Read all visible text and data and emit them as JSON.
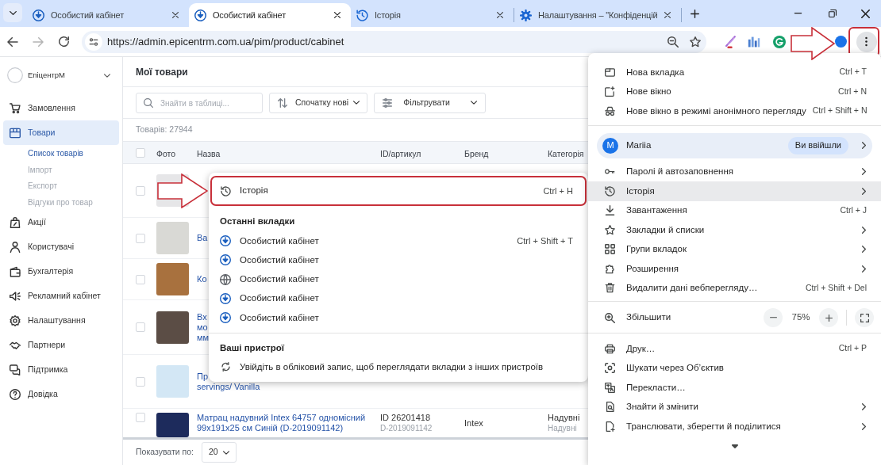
{
  "tab_strip": {
    "tabs": [
      {
        "title": "Особистий кабінет",
        "kind": "site",
        "selected": false
      },
      {
        "title": "Особистий кабінет",
        "kind": "site",
        "selected": true
      },
      {
        "title": "Історія",
        "kind": "history",
        "selected": false
      },
      {
        "title": "Налаштування – \"Конфіденцій",
        "kind": "settings",
        "selected": false
      }
    ]
  },
  "toolbar": {
    "url": "https://admin.epicentrm.com.ua/pim/product/cabinet",
    "navigation": {
      "back_disabled": false,
      "forward_disabled": true
    },
    "menu_button": {
      "annotated": true
    }
  },
  "sidebar": {
    "account": "ЕпіцентрМ",
    "items": [
      {
        "label": "Замовлення",
        "selected": false
      },
      {
        "label": "Товари",
        "selected": true,
        "children": [
          {
            "label": "Список товарів",
            "selected": true
          },
          {
            "label": "Імпорт",
            "selected": false
          },
          {
            "label": "Експорт",
            "selected": false
          },
          {
            "label": "Відгуки про товар",
            "selected": false
          }
        ]
      },
      {
        "label": "Акції",
        "selected": false
      },
      {
        "label": "Користувачі",
        "selected": false
      },
      {
        "label": "Бухгалтерія",
        "selected": false
      },
      {
        "label": "Рекламний кабінет",
        "selected": false
      },
      {
        "label": "Налаштування",
        "selected": false
      },
      {
        "label": "Партнери",
        "selected": false
      },
      {
        "label": "Підтримка",
        "selected": false
      },
      {
        "label": "Довідка",
        "selected": false
      }
    ]
  },
  "main": {
    "title": "Мої товари",
    "search": {
      "placeholder": "Знайти в таблиці..."
    },
    "sort": {
      "label": "Спочатку нові"
    },
    "filter": {
      "label": "Фільтрувати"
    },
    "count": "Товарів: 27944",
    "table": {
      "all_checked": false,
      "columns": [
        "Фото",
        "Назва",
        "ID/артикул",
        "Бренд",
        "Категорія"
      ],
      "rows": [
        {
          "checked": false
        },
        {
          "checked": false,
          "name": [
            "Ва"
          ]
        },
        {
          "checked": false,
          "name": [
            "Ко"
          ]
        },
        {
          "checked": false,
          "name": [
            "Вх",
            "мо",
            "мм"
          ]
        },
        {
          "checked": false,
          "name": [
            "Пр",
            "servings/ Vanilla"
          ]
        },
        {
          "checked": false,
          "name": [
            "Матрац надувний Intex 64757 одномісний",
            "99x191x25 см Синій (D-2019091142)"
          ],
          "id": [
            "ID 26201418",
            "D-2019091142"
          ],
          "brand": "Intex",
          "category": [
            "Надувні",
            "Надувні"
          ]
        }
      ]
    },
    "footer": {
      "label": "Показувати по:",
      "page_size": "20"
    }
  },
  "history_submenu": {
    "history_item": {
      "label": "Історія",
      "shortcut": "Ctrl + H",
      "annotated": true
    },
    "recent_heading": "Останні вкладки",
    "recent_tabs": [
      {
        "title": "Особистий кабінет",
        "kind": "site",
        "shortcut": "Ctrl + Shift + T"
      },
      {
        "title": "Особистий кабінет",
        "kind": "site"
      },
      {
        "title": "Особистий кабінет",
        "kind": "web"
      },
      {
        "title": "Особистий кабінет",
        "kind": "site"
      },
      {
        "title": "Особистий кабінет",
        "kind": "site"
      }
    ],
    "devices_heading": "Ваші пристрої",
    "sign_in_prompt": "Увійдіть в обліковий запис, щоб переглядати вкладки з інших пристроїв"
  },
  "chrome_menu": {
    "sections": [
      {
        "items": [
          {
            "kind": "command",
            "label": "Нова вкладка",
            "shortcut": "Ctrl + T",
            "submenu": false,
            "selected": false
          },
          {
            "kind": "command",
            "label": "Нове вікно",
            "shortcut": "Ctrl + N",
            "submenu": false,
            "selected": false
          },
          {
            "kind": "command",
            "label": "Нове вікно в режимі анонімного перегляду",
            "shortcut": "Ctrl + Shift + N",
            "submenu": false,
            "selected": false
          }
        ]
      },
      {
        "items": [
          {
            "kind": "profile",
            "avatar": "M",
            "name": "Mariia",
            "status": "Ви ввійшли"
          },
          {
            "kind": "command",
            "label": "Паролі й автозаповнення",
            "submenu": true,
            "selected": false
          },
          {
            "kind": "command",
            "label": "Історія",
            "submenu": true,
            "selected": true
          },
          {
            "kind": "command",
            "label": "Завантаження",
            "shortcut": "Ctrl + J",
            "submenu": false,
            "selected": false
          },
          {
            "kind": "command",
            "label": "Закладки й списки",
            "submenu": true,
            "selected": false
          },
          {
            "kind": "command",
            "label": "Групи вкладок",
            "submenu": true,
            "selected": false
          },
          {
            "kind": "command",
            "label": "Розширення",
            "submenu": true,
            "selected": false
          },
          {
            "kind": "command",
            "label": "Видалити дані вебперегляду…",
            "shortcut": "Ctrl + Shift + Del",
            "submenu": false,
            "selected": false
          }
        ]
      },
      {
        "items": [
          {
            "kind": "zoom",
            "label": "Збільшити",
            "value": "75%"
          }
        ]
      },
      {
        "items": [
          {
            "kind": "command",
            "label": "Друк…",
            "shortcut": "Ctrl + P",
            "submenu": false,
            "selected": false
          },
          {
            "kind": "command",
            "label": "Шукати через Об’єктив",
            "submenu": false,
            "selected": false
          },
          {
            "kind": "command",
            "label": "Перекласти…",
            "submenu": false,
            "selected": false
          },
          {
            "kind": "command",
            "label": "Знайти й змінити",
            "submenu": true,
            "selected": false
          },
          {
            "kind": "command",
            "label": "Транслювати, зберегти й поділитися",
            "submenu": true,
            "selected": false
          }
        ]
      }
    ],
    "more_below": true
  }
}
